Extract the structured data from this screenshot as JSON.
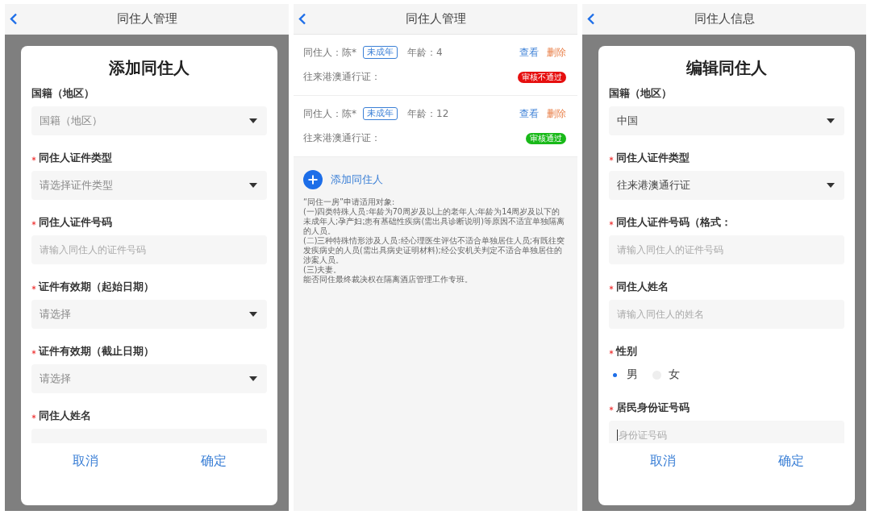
{
  "panels": [
    {
      "kind": "form_dialog",
      "header": {
        "title": "同住人管理"
      },
      "dialog": {
        "title": "添加同住人",
        "fields": [
          {
            "label": "国籍（地区）",
            "required": false,
            "kind": "select",
            "placeholder": "国籍（地区）"
          },
          {
            "label": "同住人证件类型",
            "required": true,
            "kind": "select",
            "placeholder": "请选择证件类型"
          },
          {
            "label": "同住人证件号码",
            "required": true,
            "kind": "input",
            "placeholder": "请输入同住人的证件号码"
          },
          {
            "label": "证件有效期（起始日期）",
            "required": true,
            "kind": "select",
            "placeholder": "请选择"
          },
          {
            "label": "证件有效期（截止日期）",
            "required": true,
            "kind": "select",
            "placeholder": "请选择"
          },
          {
            "label": "同住人姓名",
            "required": true,
            "kind": "input"
          }
        ],
        "buttons": [
          "取消",
          "确定"
        ]
      }
    },
    {
      "kind": "list",
      "header": {
        "title": "同住人管理"
      },
      "residents": [
        {
          "name_label": "同住人：陈*",
          "tag": "未成年",
          "age": "年龄：4",
          "document": "往来港澳通行证：",
          "actions": [
            "查看",
            "删除"
          ],
          "status": {
            "text": "审核不通过",
            "color": "#e60f0f"
          }
        },
        {
          "name_label": "同住人：陈*",
          "tag": "未成年",
          "age": "年龄：12",
          "document": "往来港澳通行证：",
          "actions": [
            "查看",
            "删除"
          ],
          "status": {
            "text": "审核通过",
            "color": "#19b919"
          }
        }
      ],
      "add_button": "添加同住人",
      "notice": [
        "“同住一房”申请适用对象:",
        "(一)四类特殊人员:年龄为70周岁及以上的老年人;年龄为14周岁及以下的未成年人;孕产妇;患有基础性疾病(需出具诊断说明)等原因不适宜单独隔离的人员。",
        "(二)三种特殊情形涉及人员:经心理医生评估不适合单独居住人员;有既往突发疾病史的人员(需出具病史证明材料);经公安机关判定不适合单独居住的涉案人员。",
        "(三)夫妻。",
        "能否同住最终裁决权在隔离酒店管理工作专班。"
      ]
    },
    {
      "kind": "form_dialog",
      "header": {
        "title": "同住人信息"
      },
      "dialog": {
        "title": "编辑同住人",
        "fields": [
          {
            "label": "国籍（地区）",
            "required": false,
            "kind": "select",
            "value": "中国"
          },
          {
            "label": "同住人证件类型",
            "required": true,
            "kind": "select",
            "value": "往来港澳通行证"
          },
          {
            "label": "同住人证件号码（格式：",
            "required": true,
            "kind": "input",
            "placeholder": "请输入同住人的证件号码"
          },
          {
            "label": "同住人姓名",
            "required": true,
            "kind": "input",
            "placeholder": "请输入同住人的姓名"
          },
          {
            "label": "性别",
            "required": true,
            "kind": "radio",
            "options": [
              {
                "label": "男",
                "selected": true
              },
              {
                "label": "女",
                "selected": false
              }
            ]
          },
          {
            "label": "居民身份证号码",
            "required": true,
            "kind": "input",
            "placeholder": "身份证号码",
            "focused": true
          }
        ],
        "buttons": [
          "取消",
          "确定"
        ]
      }
    }
  ]
}
